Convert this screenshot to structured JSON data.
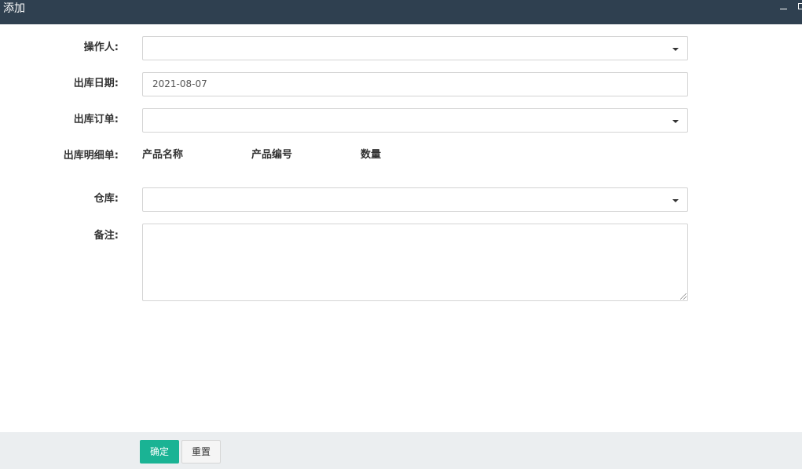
{
  "window": {
    "title": "添加"
  },
  "form": {
    "operator": {
      "label": "操作人:",
      "value": ""
    },
    "out_date": {
      "label": "出库日期:",
      "value": "2021-08-07"
    },
    "out_order": {
      "label": "出库订单:",
      "value": ""
    },
    "out_detail": {
      "label": "出库明细单:",
      "columns": [
        "产品名称",
        "产品编号",
        "数量"
      ]
    },
    "warehouse": {
      "label": "仓库:",
      "value": ""
    },
    "remark": {
      "label": "备注:",
      "value": ""
    }
  },
  "footer": {
    "confirm_label": "确定",
    "reset_label": "重置"
  },
  "colors": {
    "titlebar": "#2f4050",
    "primary": "#1ab394",
    "footer_bg": "#ebeef0"
  }
}
